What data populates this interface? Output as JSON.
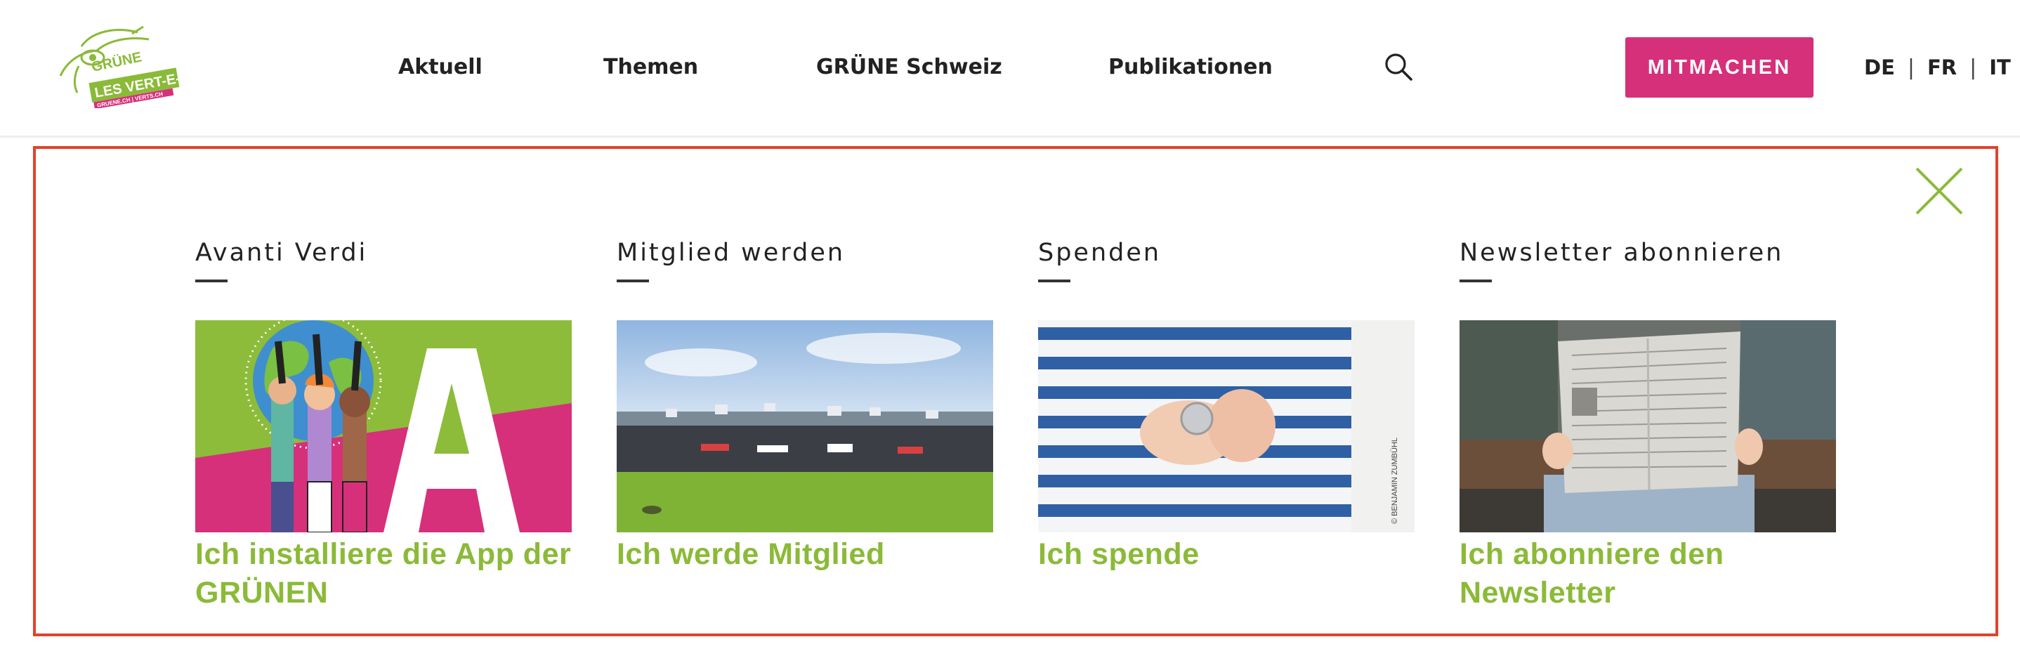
{
  "header": {
    "logo": {
      "icon": "gruene-sunflower-logo",
      "line1": "GRÜNE",
      "line2": "LES VERT-E-S",
      "url_text": "GRUENE.CH | VERTS.CH",
      "colors": {
        "green": "#8aba38",
        "pink": "#d7307a"
      }
    },
    "nav": [
      {
        "label": "Aktuell"
      },
      {
        "label": "Themen"
      },
      {
        "label": "GRÜNE Schweiz"
      },
      {
        "label": "Publikationen"
      }
    ],
    "search_icon": "search-icon",
    "cta_label": "MITMACHEN",
    "languages": [
      "DE",
      "FR",
      "IT"
    ],
    "language_separator": "|"
  },
  "panel": {
    "close_icon": "close-icon",
    "columns": [
      {
        "title": "Avanti Verdi",
        "image": "avanti-verdi-app-illustration",
        "link": "Ich installiere die App der GRÜNEN"
      },
      {
        "title": "Mitglied werden",
        "image": "crowd-demonstration-photo",
        "link": "Ich werde Mitglied"
      },
      {
        "title": "Spenden",
        "image": "child-holding-coin-photo",
        "image_credit": "© BENJAMIN ZUMBÜHL",
        "link": "Ich spende"
      },
      {
        "title": "Newsletter abonnieren",
        "image": "person-reading-newspaper-photo",
        "link": "Ich abonniere den Newsletter"
      }
    ]
  },
  "colors": {
    "accent_green": "#8aba38",
    "accent_pink": "#d7307a",
    "panel_border": "#e2412c"
  }
}
